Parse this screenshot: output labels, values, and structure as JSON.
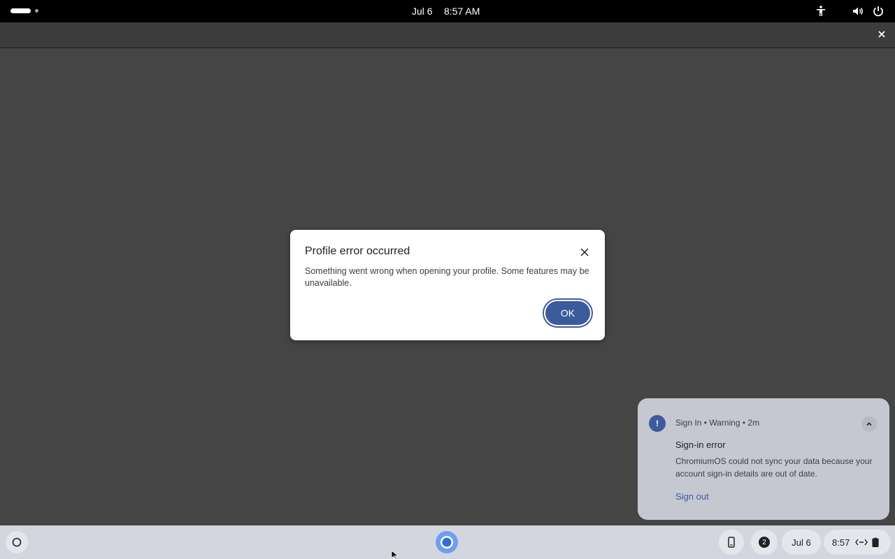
{
  "topbar": {
    "date": "Jul 6",
    "time": "8:57 AM",
    "icons": [
      "accessibility-icon",
      "volume-icon",
      "power-icon"
    ]
  },
  "dialog": {
    "title": "Profile error occurred",
    "body": "Something went wrong when opening your profile. Some features may be unavailable.",
    "ok_label": "OK",
    "accent": "#3c5b9c"
  },
  "notification": {
    "app": "Sign In",
    "severity": "Warning",
    "age": "2m",
    "title": "Sign-in error",
    "body": "ChromiumOS could not sync your data because your account sign-in details are out of date.",
    "action": "Sign out"
  },
  "shelf": {
    "notification_count": "2",
    "date": "Jul 6",
    "time": "8:57",
    "apps": [
      "chromium-icon"
    ]
  }
}
